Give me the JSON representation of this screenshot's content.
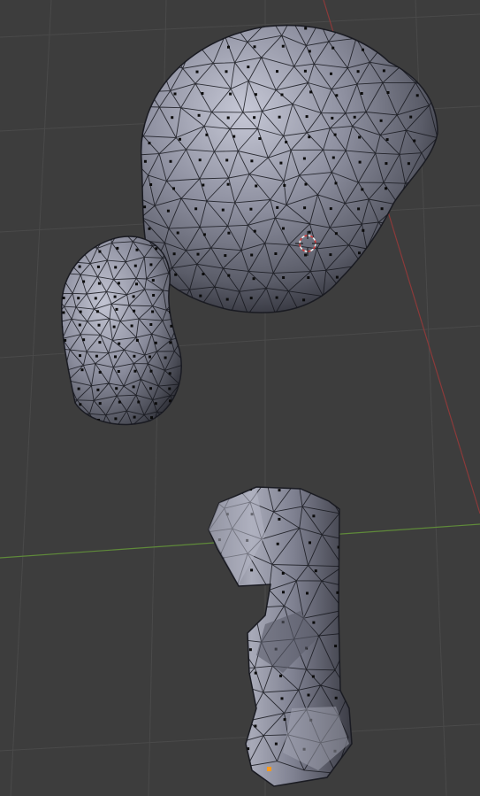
{
  "viewport": {
    "background": "#3d3d3d",
    "grid_color": "#4a4a4a",
    "x_axis_color": "#5f8a3a",
    "y_axis_color": "#8b3a3a",
    "mesh_fill": "#8e90a0",
    "mesh_shadow": "#2d2e36",
    "wire_color": "#15161c",
    "vertex_color": "#0b0b0b",
    "active_vertex_color": "#ff9a1a",
    "cursor_colors": [
      "#d43a3a",
      "#f2f2f2"
    ]
  },
  "objects": [
    {
      "name": "large-head",
      "icon": "sphere-mesh"
    },
    {
      "name": "small-head",
      "icon": "sphere-mesh"
    },
    {
      "name": "body-column",
      "icon": "column-mesh"
    }
  ],
  "cursor": {
    "icon": "3d-cursor-icon"
  }
}
